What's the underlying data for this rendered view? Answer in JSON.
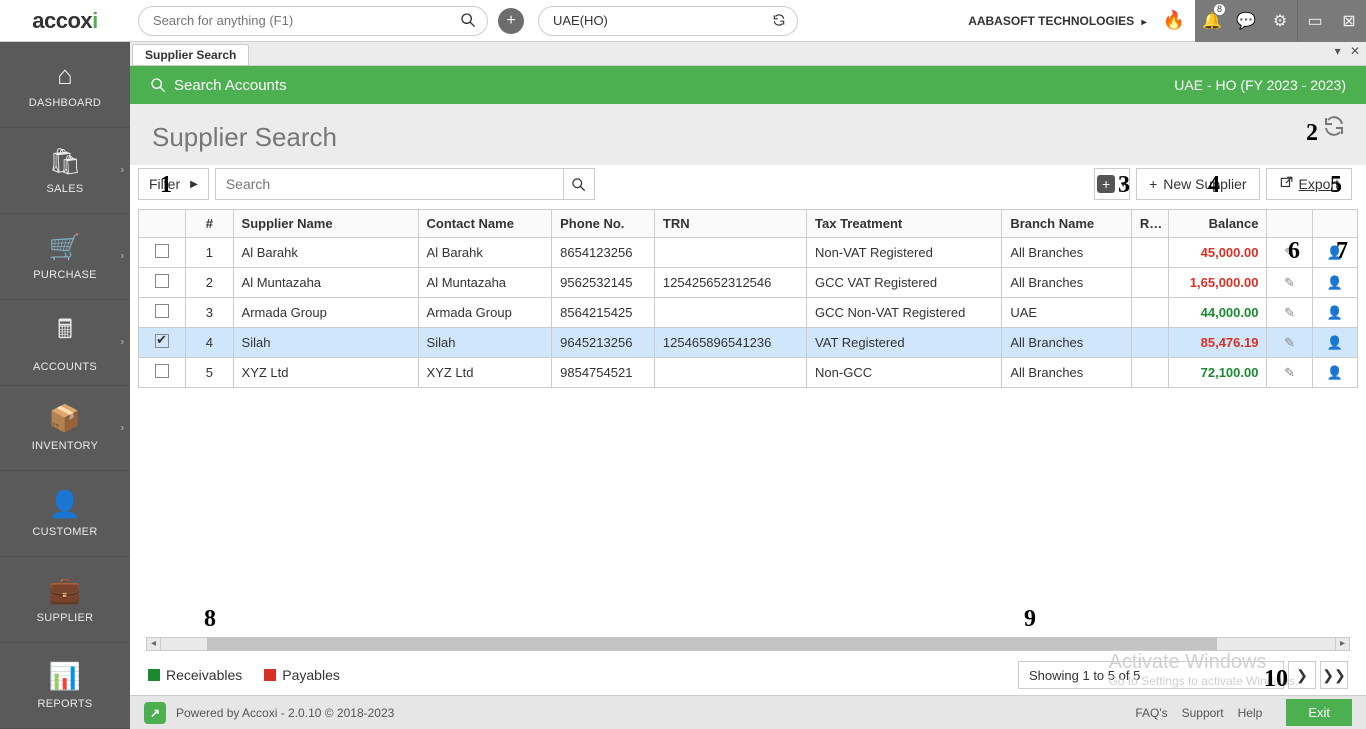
{
  "brand": {
    "text": "accox",
    "accent": "i"
  },
  "global_search": {
    "placeholder": "Search for anything (F1)"
  },
  "org": {
    "value": "UAE(HO)"
  },
  "company": {
    "name": "AABASOFT TECHNOLOGIES",
    "caret": "▸"
  },
  "notifications": {
    "count": "8"
  },
  "sidebar": {
    "items": [
      {
        "icon": "⌂",
        "label": "DASHBOARD",
        "chev": false
      },
      {
        "icon": "🛍",
        "label": "SALES",
        "chev": true
      },
      {
        "icon": "🛒",
        "label": "PURCHASE",
        "chev": true
      },
      {
        "icon": "🖩",
        "label": "ACCOUNTS",
        "chev": true
      },
      {
        "icon": "📦",
        "label": "INVENTORY",
        "chev": true
      },
      {
        "icon": "👤",
        "label": "CUSTOMER",
        "chev": false
      },
      {
        "icon": "💼",
        "label": "SUPPLIER",
        "chev": false
      },
      {
        "icon": "📊",
        "label": "REPORTS",
        "chev": false
      }
    ]
  },
  "tabs": {
    "active": "Supplier Search"
  },
  "greenbar": {
    "left": "Search Accounts",
    "right": "UAE - HO (FY 2023 - 2023)"
  },
  "page": {
    "title": "Supplier Search"
  },
  "toolbar": {
    "filter_label": "Filter",
    "search_placeholder": "Search",
    "new_supplier": "New Supplier",
    "export": "Export"
  },
  "table": {
    "headers": {
      "hash": "#",
      "supplier_name": "Supplier Name",
      "contact_name": "Contact Name",
      "phone": "Phone No.",
      "trn": "TRN",
      "tax": "Tax Treatment",
      "branch": "Branch Name",
      "route": "Rout",
      "balance": "Balance"
    },
    "rows": [
      {
        "checked": false,
        "idx": "1",
        "name": "Al Barahk",
        "contact": "Al Barahk",
        "phone": "8654123256",
        "trn": "",
        "tax": "Non-VAT Registered",
        "branch": "All Branches",
        "route": "",
        "balance": "45,000.00",
        "bal_class": "bal-red"
      },
      {
        "checked": false,
        "idx": "2",
        "name": "Al Muntazaha",
        "contact": "Al Muntazaha",
        "phone": "9562532145",
        "trn": "125425652312546",
        "tax": "GCC VAT Registered",
        "branch": "All Branches",
        "route": "",
        "balance": "1,65,000.00",
        "bal_class": "bal-red"
      },
      {
        "checked": false,
        "idx": "3",
        "name": "Armada Group",
        "contact": "Armada Group",
        "phone": "8564215425",
        "trn": "",
        "tax": "GCC Non-VAT Registered",
        "branch": "UAE",
        "route": "",
        "balance": "44,000.00",
        "bal_class": "bal-green"
      },
      {
        "checked": true,
        "idx": "4",
        "name": "Silah",
        "contact": "Silah",
        "phone": "9645213256",
        "trn": "125465896541236",
        "tax": "VAT Registered",
        "branch": "All Branches",
        "route": "",
        "balance": "85,476.19",
        "bal_class": "bal-red",
        "selected": true
      },
      {
        "checked": false,
        "idx": "5",
        "name": "XYZ Ltd",
        "contact": "XYZ Ltd",
        "phone": "9854754521",
        "trn": "",
        "tax": "Non-GCC",
        "branch": "All Branches",
        "route": "",
        "balance": "72,100.00",
        "bal_class": "bal-green"
      }
    ]
  },
  "legend": {
    "receivables": "Receivables",
    "payables": "Payables"
  },
  "pager": {
    "text": "Showing 1 to 5 of 5"
  },
  "watermark": {
    "l1": "Activate Windows",
    "l2": "Go to Settings to activate Windows."
  },
  "footer": {
    "powered": "Powered by Accoxi - 2.0.10 © 2018-2023",
    "links": {
      "faq": "FAQ's",
      "support": "Support",
      "help": "Help"
    },
    "exit": "Exit"
  },
  "annotations": {
    "n1": "1",
    "n2": "2",
    "n3": "3",
    "n4": "4",
    "n5": "5",
    "n6": "6",
    "n7": "7",
    "n8": "8",
    "n9": "9",
    "n10": "10"
  }
}
